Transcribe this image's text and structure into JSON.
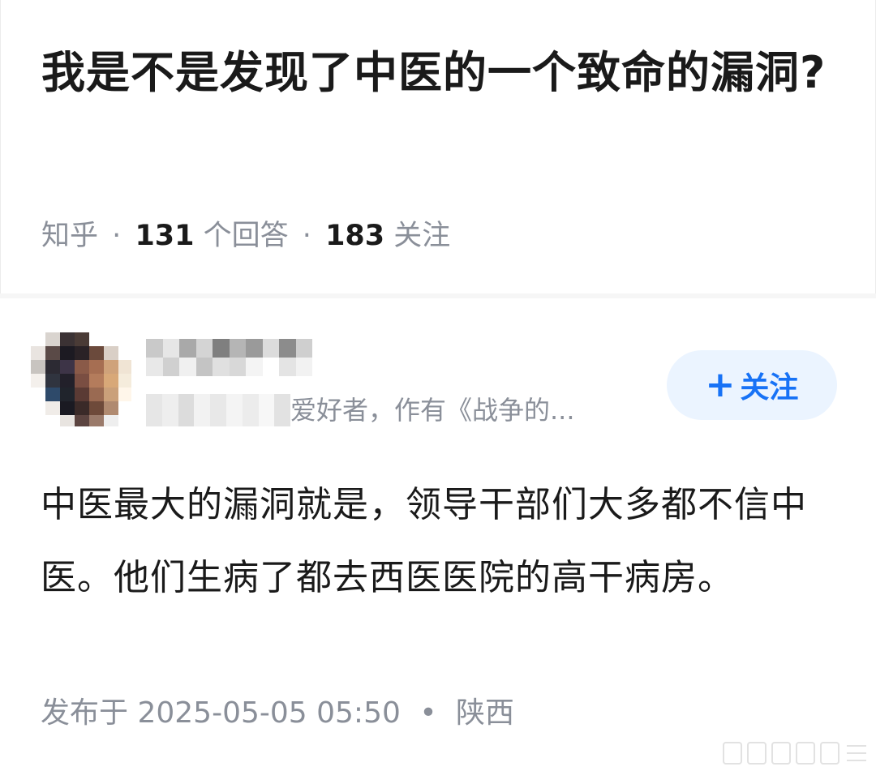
{
  "question": {
    "title": "我是不是发现了中医的一个致命的漏洞?",
    "source": "知乎",
    "sep": "·",
    "answer_count": "131",
    "answer_label": "个回答",
    "follower_count": "183",
    "follower_label": "关注"
  },
  "answer": {
    "author_bio_visible": "爱好者，作有《战争的...",
    "follow_label": "关注",
    "follow_plus": "+",
    "content": "中医最大的漏洞就是，领导干部们大多都不信中医。他们生病了都去西医医院的高干病房。",
    "published_label": "发布于",
    "published_time": "2025-05-05 05:50",
    "meta_dot": "•",
    "location": "陕西"
  },
  "colors": {
    "accent": "#1772f6",
    "follow_bg": "#ebf4ff",
    "meta_gray": "#8a8f99",
    "text": "#1a1a1a"
  }
}
